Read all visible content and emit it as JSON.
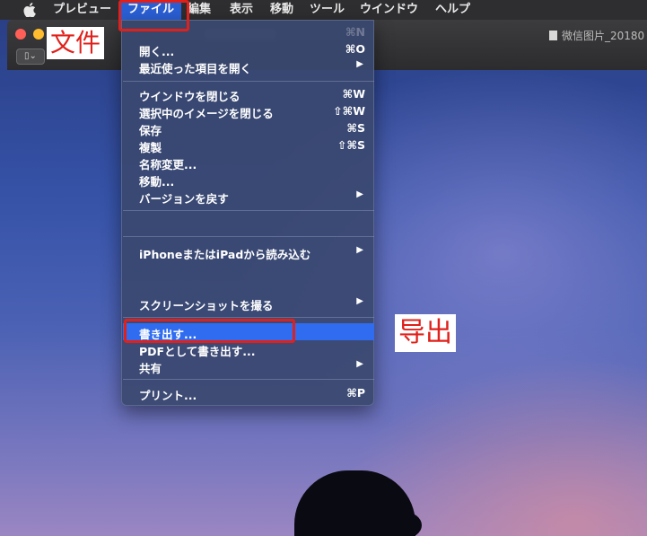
{
  "menubar": {
    "apple_icon": "apple-logo-icon",
    "items": [
      {
        "label": "プレビュー"
      },
      {
        "label": "ファイル"
      },
      {
        "label": "編集"
      },
      {
        "label": "表示"
      },
      {
        "label": "移動"
      },
      {
        "label": "ツール"
      },
      {
        "label": "ウインドウ"
      },
      {
        "label": "ヘルプ"
      }
    ]
  },
  "window": {
    "title": "微信图片_20180",
    "sidebar_toggle": "▯⌄"
  },
  "file_menu": {
    "items": [
      {
        "label": "開く...",
        "shortcut": "⌘O"
      },
      {
        "label": "最近使った項目を開く",
        "submenu": "▶"
      },
      {
        "label": "ウインドウを閉じる",
        "shortcut": "⌘W"
      },
      {
        "label": "選択中のイメージを閉じる",
        "shortcut": "⇧⌘W"
      },
      {
        "label": "保存",
        "shortcut": "⌘S"
      },
      {
        "label": "複製",
        "shortcut": "⇧⌘S"
      },
      {
        "label": "名称変更..."
      },
      {
        "label": "移動..."
      },
      {
        "label": "バージョンを戻す",
        "submenu": "▶"
      },
      {
        "label": "iPhoneまたはiPadから読み込む",
        "submenu": "▶"
      },
      {
        "label": "スクリーンショットを撮る",
        "submenu": "▶"
      },
      {
        "label": "書き出す..."
      },
      {
        "label": "PDFとして書き出す..."
      },
      {
        "label": "共有",
        "submenu": "▶"
      },
      {
        "label": "プリント...",
        "shortcut": "⌘P"
      }
    ],
    "shortcut_n": "⌘N"
  },
  "annotations": {
    "file_label": "文件",
    "export_label": "导出"
  },
  "colors": {
    "menu_highlight": "#2f6cf0",
    "annotation_red": "#e0201a",
    "close_button": "#ff5f57",
    "minimize_button": "#febc2e"
  }
}
